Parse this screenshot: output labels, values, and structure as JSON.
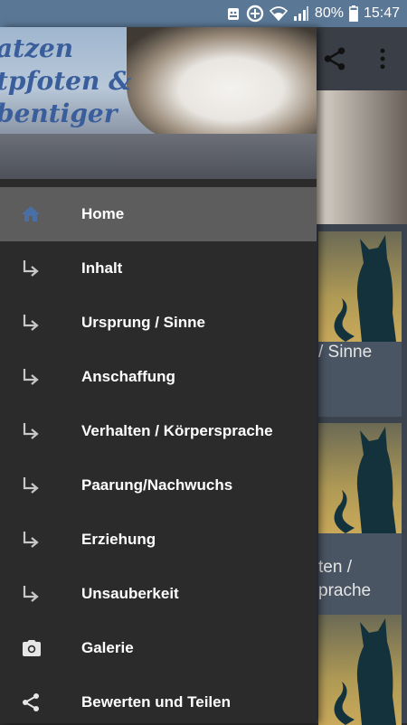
{
  "status_bar": {
    "battery": "80%",
    "time": "15:47",
    "icons": [
      "android-notification-icon",
      "data-saver-icon",
      "wifi-icon",
      "signal-icon",
      "battery-icon"
    ]
  },
  "background": {
    "card_captions": [
      "/ Sinne",
      "ten /",
      "prache"
    ],
    "toolbar_icons": [
      "share-icon",
      "more-vert-icon"
    ]
  },
  "drawer": {
    "header_title": "atzen\ntpfoten &\nbentiger",
    "items": [
      {
        "label": "Home",
        "icon": "home-icon",
        "active": true
      },
      {
        "label": "Inhalt",
        "icon": "subdirectory-arrow-icon"
      },
      {
        "label": "Ursprung / Sinne",
        "icon": "subdirectory-arrow-icon"
      },
      {
        "label": "Anschaffung",
        "icon": "subdirectory-arrow-icon"
      },
      {
        "label": "Verhalten / Körpersprache",
        "icon": "subdirectory-arrow-icon"
      },
      {
        "label": "Paarung/Nachwuchs",
        "icon": "subdirectory-arrow-icon"
      },
      {
        "label": "Erziehung",
        "icon": "subdirectory-arrow-icon"
      },
      {
        "label": "Unsauberkeit",
        "icon": "subdirectory-arrow-icon"
      },
      {
        "label": "Galerie",
        "icon": "camera-icon"
      },
      {
        "label": "Bewerten und Teilen",
        "icon": "share-icon"
      }
    ]
  },
  "colors": {
    "status_bar": "#5a7896",
    "drawer_bg": "#2b2b2b",
    "active_item_bg": "#5d5d5d",
    "home_icon": "#4a6fa5",
    "arrow_icon": "#c8c8c8"
  }
}
